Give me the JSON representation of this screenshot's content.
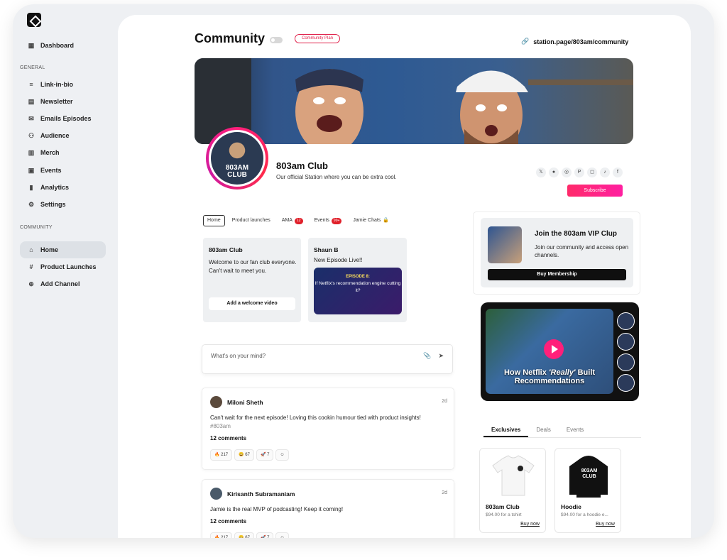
{
  "sidebar": {
    "dashboard": "Dashboard",
    "general_head": "GENERAL",
    "general_items": [
      "Link-in-bio",
      "Newsletter",
      "Emails Episodes",
      "Audience",
      "Merch",
      "Events",
      "Analytics",
      "Settings"
    ],
    "community_head": "COMMUNITY",
    "community_items": [
      "Home",
      "Product Launches",
      "Add Channel"
    ]
  },
  "header": {
    "title": "Community",
    "plan_badge": "Community Plan",
    "page_url": "station.page/803am/community"
  },
  "profile": {
    "avatar_text_1": "803AM",
    "avatar_text_2": "CLUB",
    "name": "803am Club",
    "description": "Our official Station where you can be extra cool.",
    "subscribe_label": "Subscribe",
    "socials": [
      "x-icon",
      "spotify-icon",
      "podcast-icon",
      "patreon-icon",
      "instagram-icon",
      "tiktok-icon",
      "facebook-icon"
    ]
  },
  "tabs": [
    {
      "label": "Home",
      "active": true
    },
    {
      "label": "Product launches"
    },
    {
      "label": "AMA",
      "badge": "12"
    },
    {
      "label": "Events",
      "badge": "99+"
    },
    {
      "label": "Jamie Chats",
      "locked": true
    }
  ],
  "welcome_card": {
    "who": "803am Club",
    "message": "Welcome to our fan club everyone. Can't wait to meet you.",
    "button": "Add a welcome video"
  },
  "episode_card": {
    "who": "Shaun B",
    "message": "New Episode Live!!",
    "episode_label": "EPISODE 8:",
    "episode_title": "If Netflix's recommendation engine cutting it?"
  },
  "composer": {
    "placeholder": "What's on your mind?"
  },
  "posts": [
    {
      "name": "Miloni Sheth",
      "time": "2d",
      "text": "Can't wait for the next episode! Loving this cookin humour tied with product insights!",
      "tag": "#803am",
      "comments": "12 comments",
      "reactions": [
        "🔥 217",
        "😄 67",
        "🚀 7"
      ]
    },
    {
      "name": "Kirisanth Subramaniam",
      "time": "2d",
      "text": "Jamie is the real MVP of podcasting! Keep it coming!",
      "tag": "",
      "comments": "12 comments",
      "reactions": [
        "🔥 217",
        "😄 67",
        "🚀 7"
      ]
    }
  ],
  "vip": {
    "title": "Join the 803am VIP Clup",
    "description": "Join our community and access open channels.",
    "button": "Buy Membership"
  },
  "video": {
    "title_1": "How Netflix ",
    "title_em": "'Really'",
    "title_2": " Built Recommendations"
  },
  "shop": {
    "tabs": [
      "Exclusives",
      "Deals",
      "Events"
    ],
    "products": [
      {
        "name": "803am Club",
        "price": "$94.00 for a tshirt",
        "buy": "Buy now"
      },
      {
        "name": "Hoodie",
        "price": "$94.00 for a hoodie e...",
        "buy": "Buy now",
        "print": "803AM CLUB"
      }
    ]
  }
}
